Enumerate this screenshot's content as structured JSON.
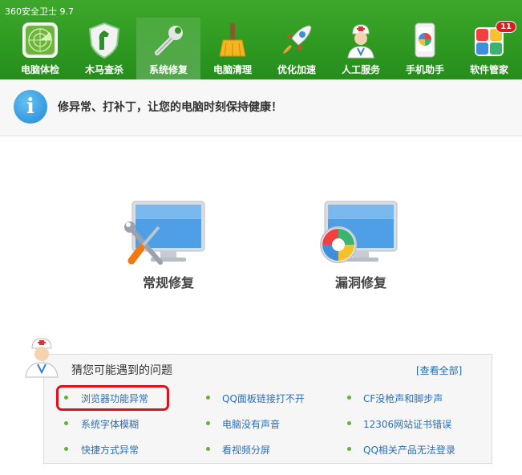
{
  "app": {
    "title": "360安全卫士 9.7"
  },
  "nav": {
    "items": [
      {
        "label": "电脑体检"
      },
      {
        "label": "木马查杀"
      },
      {
        "label": "系统修复"
      },
      {
        "label": "电脑清理"
      },
      {
        "label": "优化加速"
      },
      {
        "label": "人工服务"
      },
      {
        "label": "手机助手"
      },
      {
        "label": "软件管家",
        "badge": "11"
      }
    ]
  },
  "info": {
    "text": "修异常、打补丁，让您的电脑时刻保持健康！"
  },
  "repair": {
    "normal_label": "常规修复",
    "vuln_label": "漏洞修复"
  },
  "problems": {
    "title": "猜您可能遇到的问题",
    "view_all": "[查看全部]",
    "items": [
      "浏览器功能异常",
      "QQ面板链接打不开",
      "CF没枪声和脚步声",
      "系统字体模糊",
      "电脑没有声音",
      "12306网站证书错误",
      "快捷方式异常",
      "看视频分屏",
      "QQ相关产品无法登录"
    ]
  },
  "colors": {
    "header_green": "#2f9a22",
    "link_blue": "#2a6fb6",
    "highlight_red": "#e0101a"
  }
}
